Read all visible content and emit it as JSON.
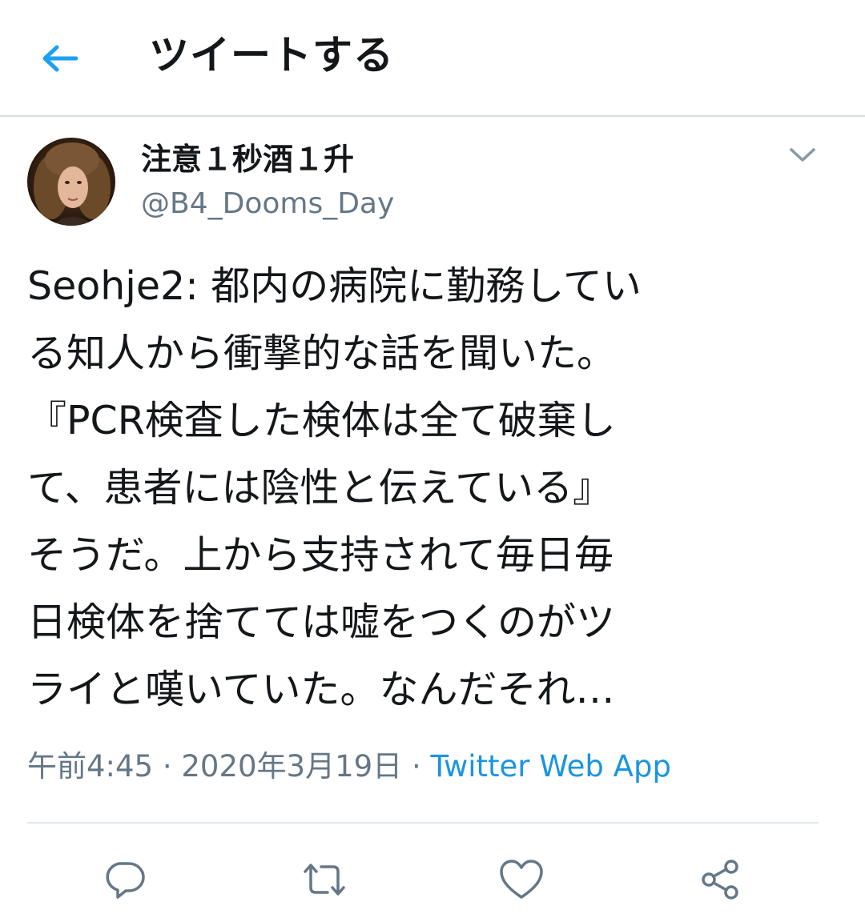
{
  "header": {
    "back_icon": "arrow-left-icon",
    "title": "ツイートする"
  },
  "colors": {
    "accent": "#1da1f2",
    "link": "#1b95e0",
    "muted": "#657786",
    "text": "#14171a",
    "icon": "#657786"
  },
  "tweet": {
    "display_name": "注意１秒酒１升",
    "handle": "@B4_Dooms_Day",
    "text_lines": [
      "Seohje2: 都内の病院に勤務してい",
      "る知人から衝撃的な話を聞いた。",
      "『PCR検査した検体は全て破棄し",
      "て、患者には陰性と伝えている』",
      "そうだ。上から支持されて毎日毎",
      "日検体を捨てては嘘をつくのがツ",
      "ライと嘆いていた。なんだそれ…"
    ],
    "time": "午前4:45",
    "separator": " · ",
    "date": "2020年3月19日",
    "separator2": " · ",
    "source": "Twitter Web App"
  },
  "actions": [
    {
      "icon": "reply-icon"
    },
    {
      "icon": "retweet-icon"
    },
    {
      "icon": "like-heart-icon"
    },
    {
      "icon": "share-icon"
    }
  ]
}
